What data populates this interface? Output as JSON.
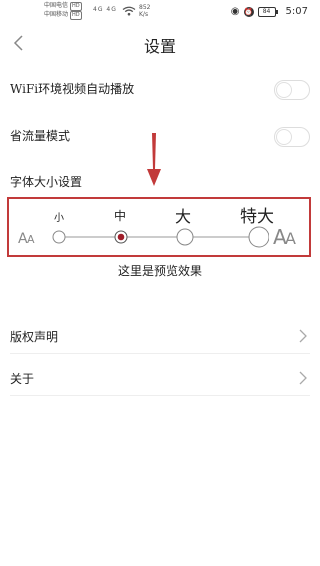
{
  "status": {
    "carrier1": "中国电信",
    "carrier1_badge": "HD",
    "carrier2": "中国移动",
    "carrier2_badge": "HD",
    "network": "4G 4G",
    "speed": "852",
    "speed_unit": "K/s",
    "battery": "84",
    "time": "5:07"
  },
  "header": {
    "title": "设置"
  },
  "settings": {
    "wifi_autoplay": {
      "label": "WiFi环境视频自动播放",
      "enabled": false
    },
    "data_saver": {
      "label": "省流量模式",
      "enabled": false
    },
    "font_size_label": "字体大小设置"
  },
  "font_size": {
    "options": [
      "小",
      "中",
      "大",
      "特大"
    ],
    "selected_index": 1,
    "preview_text": "这里是预览效果"
  },
  "menu": {
    "copyright": "版权声明",
    "about": "关于"
  },
  "annotation": {
    "arrow_color": "#c23a3a",
    "box_color": "#c23a3a"
  }
}
